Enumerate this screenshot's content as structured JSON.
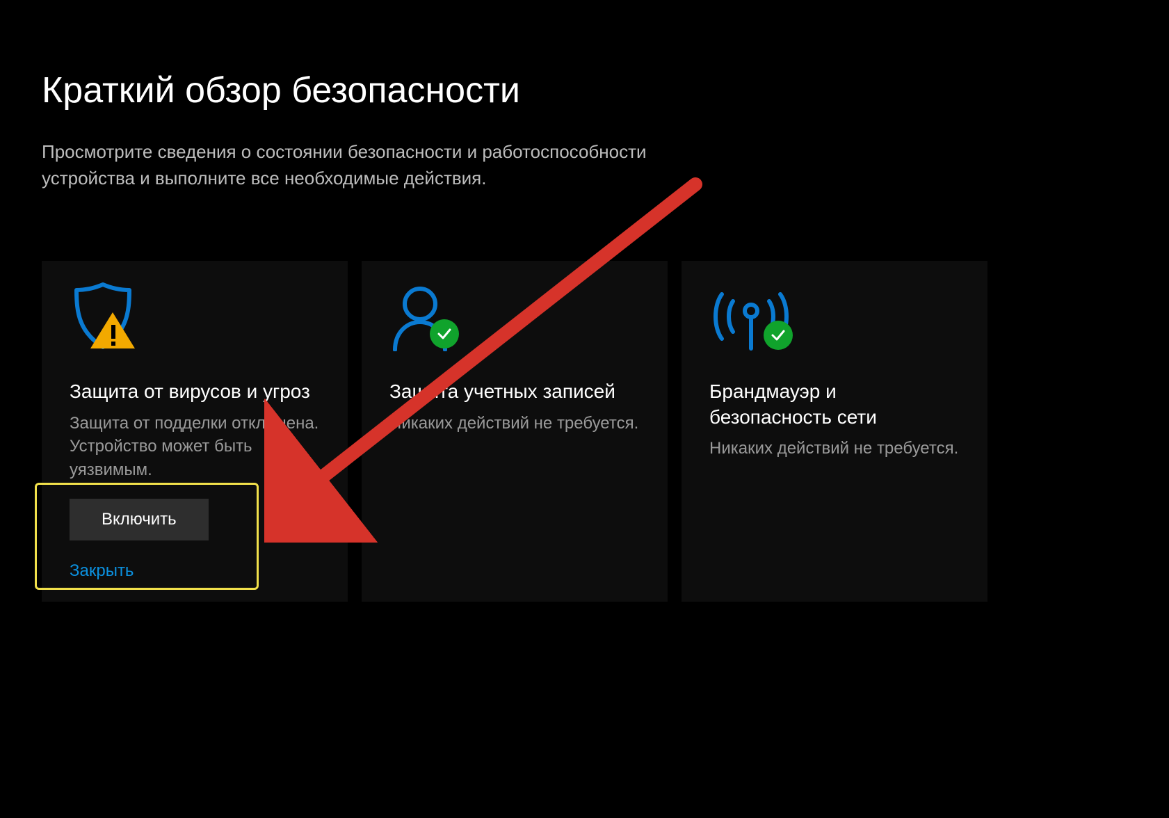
{
  "header": {
    "title": "Краткий обзор безопасности",
    "subtitle": "Просмотрите сведения о состоянии безопасности и работоспособности устройства и выполните все необходимые действия."
  },
  "cards": [
    {
      "icon": "shield-warning",
      "title": "Защита от вирусов и угроз",
      "description": "Защита от подделки отключена. Устройство может быть уязвимым.",
      "action_label": "Включить",
      "dismiss_label": "Закрыть",
      "status": "warning"
    },
    {
      "icon": "person",
      "title": "Защита учетных записей",
      "description": "Никаких действий не требуется.",
      "status": "ok"
    },
    {
      "icon": "network",
      "title": "Брандмауэр и безопасность сети",
      "description": "Никаких действий не требуется.",
      "status": "ok"
    }
  ],
  "annotation": {
    "highlight_target": "enable-button",
    "arrow_color": "#d6332a",
    "highlight_color": "#f1e04b"
  },
  "colors": {
    "accent_blue": "#0a7ad1",
    "status_ok": "#10a32c",
    "status_warn": "#f2a900",
    "link": "#0b91e0"
  }
}
